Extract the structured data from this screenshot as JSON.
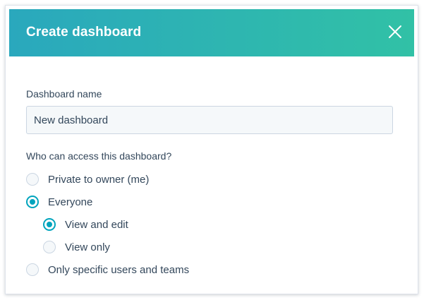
{
  "dialog": {
    "title": "Create dashboard",
    "close_icon": "close-icon"
  },
  "form": {
    "name_label": "Dashboard name",
    "name_value": "New dashboard",
    "access_label": "Who can access this dashboard?",
    "options": [
      {
        "label": "Private to owner (me)",
        "checked": false
      },
      {
        "label": "Everyone",
        "checked": true
      },
      {
        "label": "View and edit",
        "checked": true
      },
      {
        "label": "View only",
        "checked": false
      },
      {
        "label": "Only specific users and teams",
        "checked": false
      }
    ]
  },
  "colors": {
    "header_gradient_start": "#2aa8bd",
    "header_gradient_end": "#31c1a6",
    "accent": "#00a4bd",
    "text": "#33475b"
  }
}
